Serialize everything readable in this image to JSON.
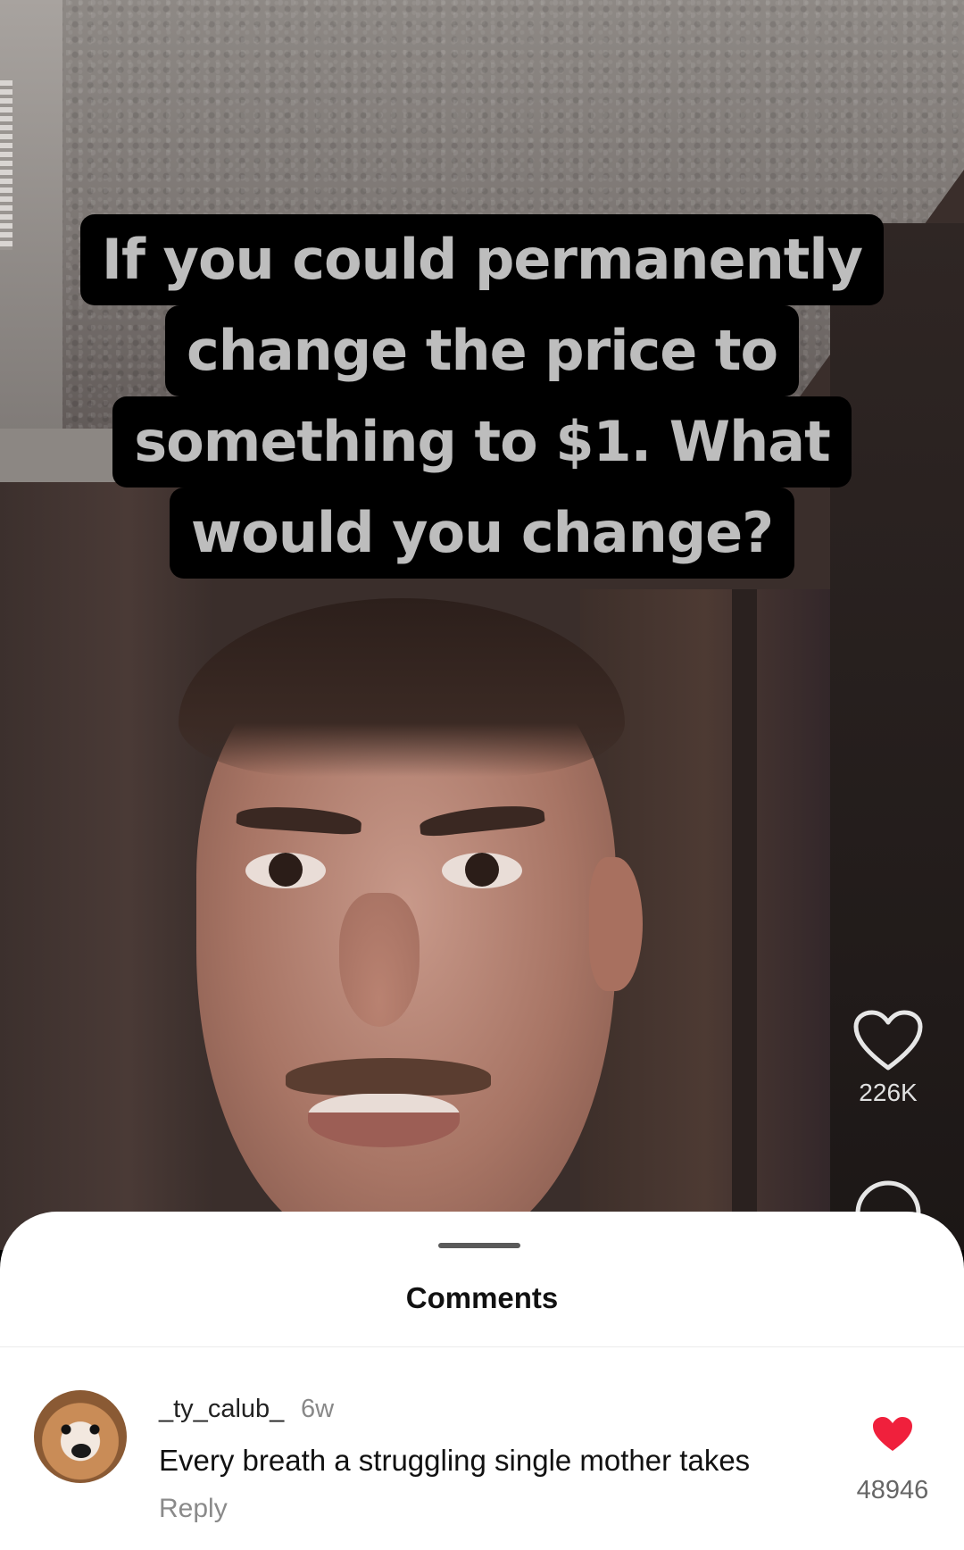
{
  "video": {
    "caption_lines": [
      "If you could permanently",
      "change the price to",
      "something to $1. What",
      "would you change?"
    ],
    "like_count": "226K",
    "icons": {
      "like": "heart-outline-icon",
      "comment": "comment-bubble-icon"
    }
  },
  "comments_sheet": {
    "title": "Comments",
    "items": [
      {
        "username": "_ty_calub_",
        "time": "6w",
        "text": "Every breath a struggling single mother takes",
        "reply_label": "Reply",
        "likes": "48946",
        "liked": true
      }
    ]
  },
  "colors": {
    "caption_background": "#000000",
    "caption_text": "#bdbdbd",
    "sheet_background": "#ffffff",
    "heart_liked": "#f0203c"
  }
}
